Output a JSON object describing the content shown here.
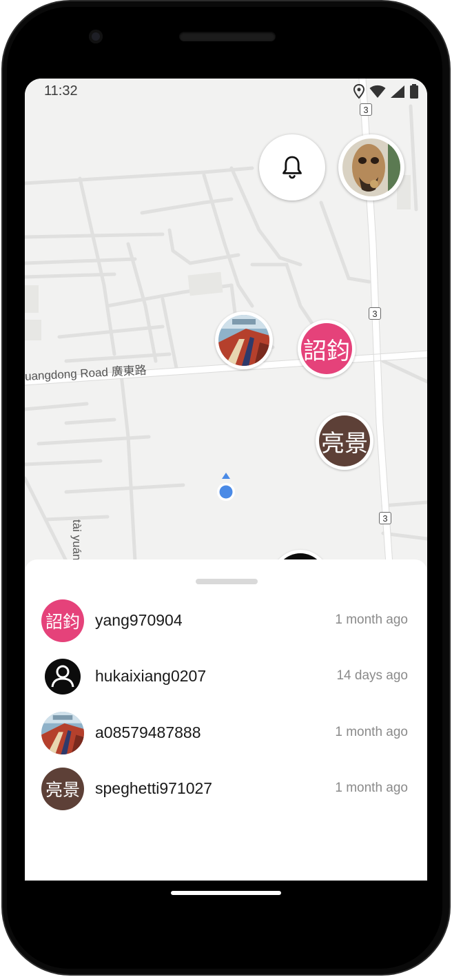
{
  "status_bar": {
    "time": "11:32"
  },
  "map": {
    "road_labels": {
      "guangdong": "uangdong Road 廣東路",
      "taiyuan": "tài yuán yī lù"
    },
    "route_shield": "3",
    "markers": [
      {
        "kind": "photo"
      },
      {
        "kind": "text",
        "text": "詔鈞",
        "color": "#e5427a"
      },
      {
        "kind": "text",
        "text": "亮景",
        "color": "#5d4037"
      }
    ]
  },
  "sheet": {
    "users": [
      {
        "name": "yang970904",
        "time": "1 month ago",
        "avatar_text": "詔鈞",
        "avatar_color": "#e5427a"
      },
      {
        "name": "hukaixiang0207",
        "time": "14 days ago",
        "avatar_icon": "person-icon"
      },
      {
        "name": "a08579487888",
        "time": "1 month ago",
        "avatar_icon": "photo-avatar"
      },
      {
        "name": "speghetti971027",
        "time": "1 month ago",
        "avatar_text": "亮景",
        "avatar_color": "#5d4037"
      }
    ]
  },
  "colors": {
    "location_dot": "#4a8ae6",
    "pink": "#e5427a",
    "brown": "#5d4037"
  }
}
